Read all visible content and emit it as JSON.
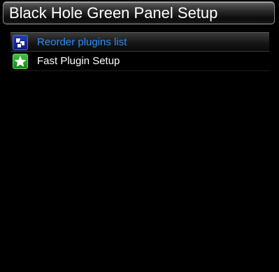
{
  "window": {
    "title": "Black Hole Green Panel Setup"
  },
  "menu": {
    "items": [
      {
        "label": "Reorder plugins list",
        "icon": "reorder-icon",
        "selected": true
      },
      {
        "label": "Fast Plugin Setup",
        "icon": "star-icon",
        "selected": false
      }
    ]
  },
  "colors": {
    "selected_text": "#2a8cf5",
    "normal_text": "#ffffff",
    "background": "#000000"
  }
}
